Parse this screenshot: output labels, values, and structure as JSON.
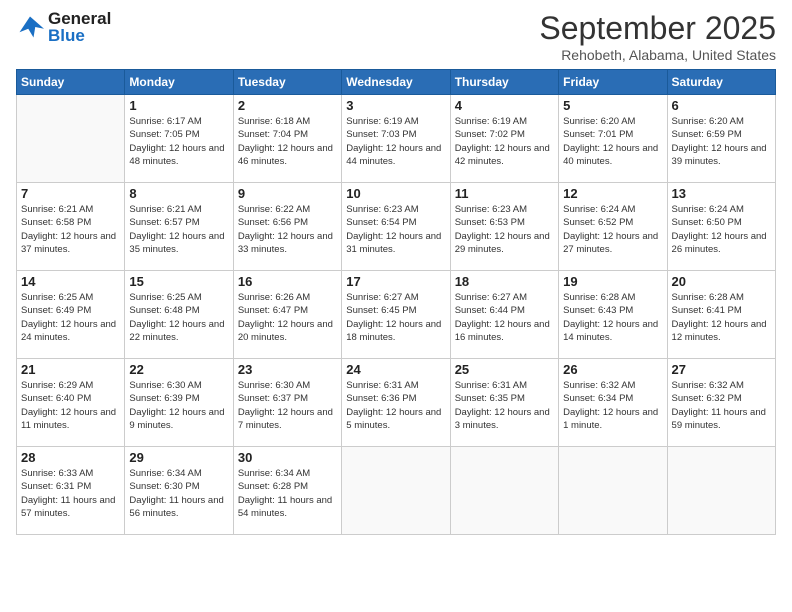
{
  "header": {
    "logo_general": "General",
    "logo_blue": "Blue",
    "month_title": "September 2025",
    "location": "Rehobeth, Alabama, United States"
  },
  "weekdays": [
    "Sunday",
    "Monday",
    "Tuesday",
    "Wednesday",
    "Thursday",
    "Friday",
    "Saturday"
  ],
  "weeks": [
    [
      {
        "day": "",
        "sunrise": "",
        "sunset": "",
        "daylight": ""
      },
      {
        "day": "1",
        "sunrise": "Sunrise: 6:17 AM",
        "sunset": "Sunset: 7:05 PM",
        "daylight": "Daylight: 12 hours and 48 minutes."
      },
      {
        "day": "2",
        "sunrise": "Sunrise: 6:18 AM",
        "sunset": "Sunset: 7:04 PM",
        "daylight": "Daylight: 12 hours and 46 minutes."
      },
      {
        "day": "3",
        "sunrise": "Sunrise: 6:19 AM",
        "sunset": "Sunset: 7:03 PM",
        "daylight": "Daylight: 12 hours and 44 minutes."
      },
      {
        "day": "4",
        "sunrise": "Sunrise: 6:19 AM",
        "sunset": "Sunset: 7:02 PM",
        "daylight": "Daylight: 12 hours and 42 minutes."
      },
      {
        "day": "5",
        "sunrise": "Sunrise: 6:20 AM",
        "sunset": "Sunset: 7:01 PM",
        "daylight": "Daylight: 12 hours and 40 minutes."
      },
      {
        "day": "6",
        "sunrise": "Sunrise: 6:20 AM",
        "sunset": "Sunset: 6:59 PM",
        "daylight": "Daylight: 12 hours and 39 minutes."
      }
    ],
    [
      {
        "day": "7",
        "sunrise": "Sunrise: 6:21 AM",
        "sunset": "Sunset: 6:58 PM",
        "daylight": "Daylight: 12 hours and 37 minutes."
      },
      {
        "day": "8",
        "sunrise": "Sunrise: 6:21 AM",
        "sunset": "Sunset: 6:57 PM",
        "daylight": "Daylight: 12 hours and 35 minutes."
      },
      {
        "day": "9",
        "sunrise": "Sunrise: 6:22 AM",
        "sunset": "Sunset: 6:56 PM",
        "daylight": "Daylight: 12 hours and 33 minutes."
      },
      {
        "day": "10",
        "sunrise": "Sunrise: 6:23 AM",
        "sunset": "Sunset: 6:54 PM",
        "daylight": "Daylight: 12 hours and 31 minutes."
      },
      {
        "day": "11",
        "sunrise": "Sunrise: 6:23 AM",
        "sunset": "Sunset: 6:53 PM",
        "daylight": "Daylight: 12 hours and 29 minutes."
      },
      {
        "day": "12",
        "sunrise": "Sunrise: 6:24 AM",
        "sunset": "Sunset: 6:52 PM",
        "daylight": "Daylight: 12 hours and 27 minutes."
      },
      {
        "day": "13",
        "sunrise": "Sunrise: 6:24 AM",
        "sunset": "Sunset: 6:50 PM",
        "daylight": "Daylight: 12 hours and 26 minutes."
      }
    ],
    [
      {
        "day": "14",
        "sunrise": "Sunrise: 6:25 AM",
        "sunset": "Sunset: 6:49 PM",
        "daylight": "Daylight: 12 hours and 24 minutes."
      },
      {
        "day": "15",
        "sunrise": "Sunrise: 6:25 AM",
        "sunset": "Sunset: 6:48 PM",
        "daylight": "Daylight: 12 hours and 22 minutes."
      },
      {
        "day": "16",
        "sunrise": "Sunrise: 6:26 AM",
        "sunset": "Sunset: 6:47 PM",
        "daylight": "Daylight: 12 hours and 20 minutes."
      },
      {
        "day": "17",
        "sunrise": "Sunrise: 6:27 AM",
        "sunset": "Sunset: 6:45 PM",
        "daylight": "Daylight: 12 hours and 18 minutes."
      },
      {
        "day": "18",
        "sunrise": "Sunrise: 6:27 AM",
        "sunset": "Sunset: 6:44 PM",
        "daylight": "Daylight: 12 hours and 16 minutes."
      },
      {
        "day": "19",
        "sunrise": "Sunrise: 6:28 AM",
        "sunset": "Sunset: 6:43 PM",
        "daylight": "Daylight: 12 hours and 14 minutes."
      },
      {
        "day": "20",
        "sunrise": "Sunrise: 6:28 AM",
        "sunset": "Sunset: 6:41 PM",
        "daylight": "Daylight: 12 hours and 12 minutes."
      }
    ],
    [
      {
        "day": "21",
        "sunrise": "Sunrise: 6:29 AM",
        "sunset": "Sunset: 6:40 PM",
        "daylight": "Daylight: 12 hours and 11 minutes."
      },
      {
        "day": "22",
        "sunrise": "Sunrise: 6:30 AM",
        "sunset": "Sunset: 6:39 PM",
        "daylight": "Daylight: 12 hours and 9 minutes."
      },
      {
        "day": "23",
        "sunrise": "Sunrise: 6:30 AM",
        "sunset": "Sunset: 6:37 PM",
        "daylight": "Daylight: 12 hours and 7 minutes."
      },
      {
        "day": "24",
        "sunrise": "Sunrise: 6:31 AM",
        "sunset": "Sunset: 6:36 PM",
        "daylight": "Daylight: 12 hours and 5 minutes."
      },
      {
        "day": "25",
        "sunrise": "Sunrise: 6:31 AM",
        "sunset": "Sunset: 6:35 PM",
        "daylight": "Daylight: 12 hours and 3 minutes."
      },
      {
        "day": "26",
        "sunrise": "Sunrise: 6:32 AM",
        "sunset": "Sunset: 6:34 PM",
        "daylight": "Daylight: 12 hours and 1 minute."
      },
      {
        "day": "27",
        "sunrise": "Sunrise: 6:32 AM",
        "sunset": "Sunset: 6:32 PM",
        "daylight": "Daylight: 11 hours and 59 minutes."
      }
    ],
    [
      {
        "day": "28",
        "sunrise": "Sunrise: 6:33 AM",
        "sunset": "Sunset: 6:31 PM",
        "daylight": "Daylight: 11 hours and 57 minutes."
      },
      {
        "day": "29",
        "sunrise": "Sunrise: 6:34 AM",
        "sunset": "Sunset: 6:30 PM",
        "daylight": "Daylight: 11 hours and 56 minutes."
      },
      {
        "day": "30",
        "sunrise": "Sunrise: 6:34 AM",
        "sunset": "Sunset: 6:28 PM",
        "daylight": "Daylight: 11 hours and 54 minutes."
      },
      {
        "day": "",
        "sunrise": "",
        "sunset": "",
        "daylight": ""
      },
      {
        "day": "",
        "sunrise": "",
        "sunset": "",
        "daylight": ""
      },
      {
        "day": "",
        "sunrise": "",
        "sunset": "",
        "daylight": ""
      },
      {
        "day": "",
        "sunrise": "",
        "sunset": "",
        "daylight": ""
      }
    ]
  ]
}
